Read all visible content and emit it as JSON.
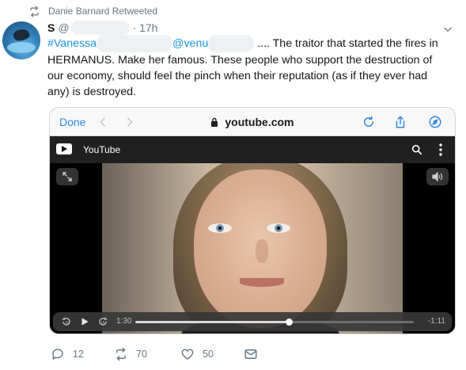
{
  "retweet": {
    "text": "Danie Barnard Retweeted"
  },
  "tweet": {
    "author_initial": "S",
    "author_handle_visible": "@",
    "time": "· 17h",
    "hashtag_prefix": "#Vanessa",
    "mention_prefix": "@venu",
    "body_line1_end": ".... The traitor that started the fires in",
    "body_rest": "HERMANUS. Make her famous. These people who support the destruction of our economy, should feel the pinch when their reputation (as if they ever had any) is destroyed."
  },
  "browser": {
    "done_label": "Done",
    "url": "youtube.com"
  },
  "youtube": {
    "title": "YouTube",
    "time_elapsed": "1:30",
    "time_remaining": "-1:11",
    "progress": 0.55
  },
  "actions": {
    "replies": "12",
    "retweets": "70",
    "likes": "50"
  },
  "colors": {
    "link": "#1b95e0",
    "muted": "#657786",
    "safari_blue": "#2f88e0"
  }
}
